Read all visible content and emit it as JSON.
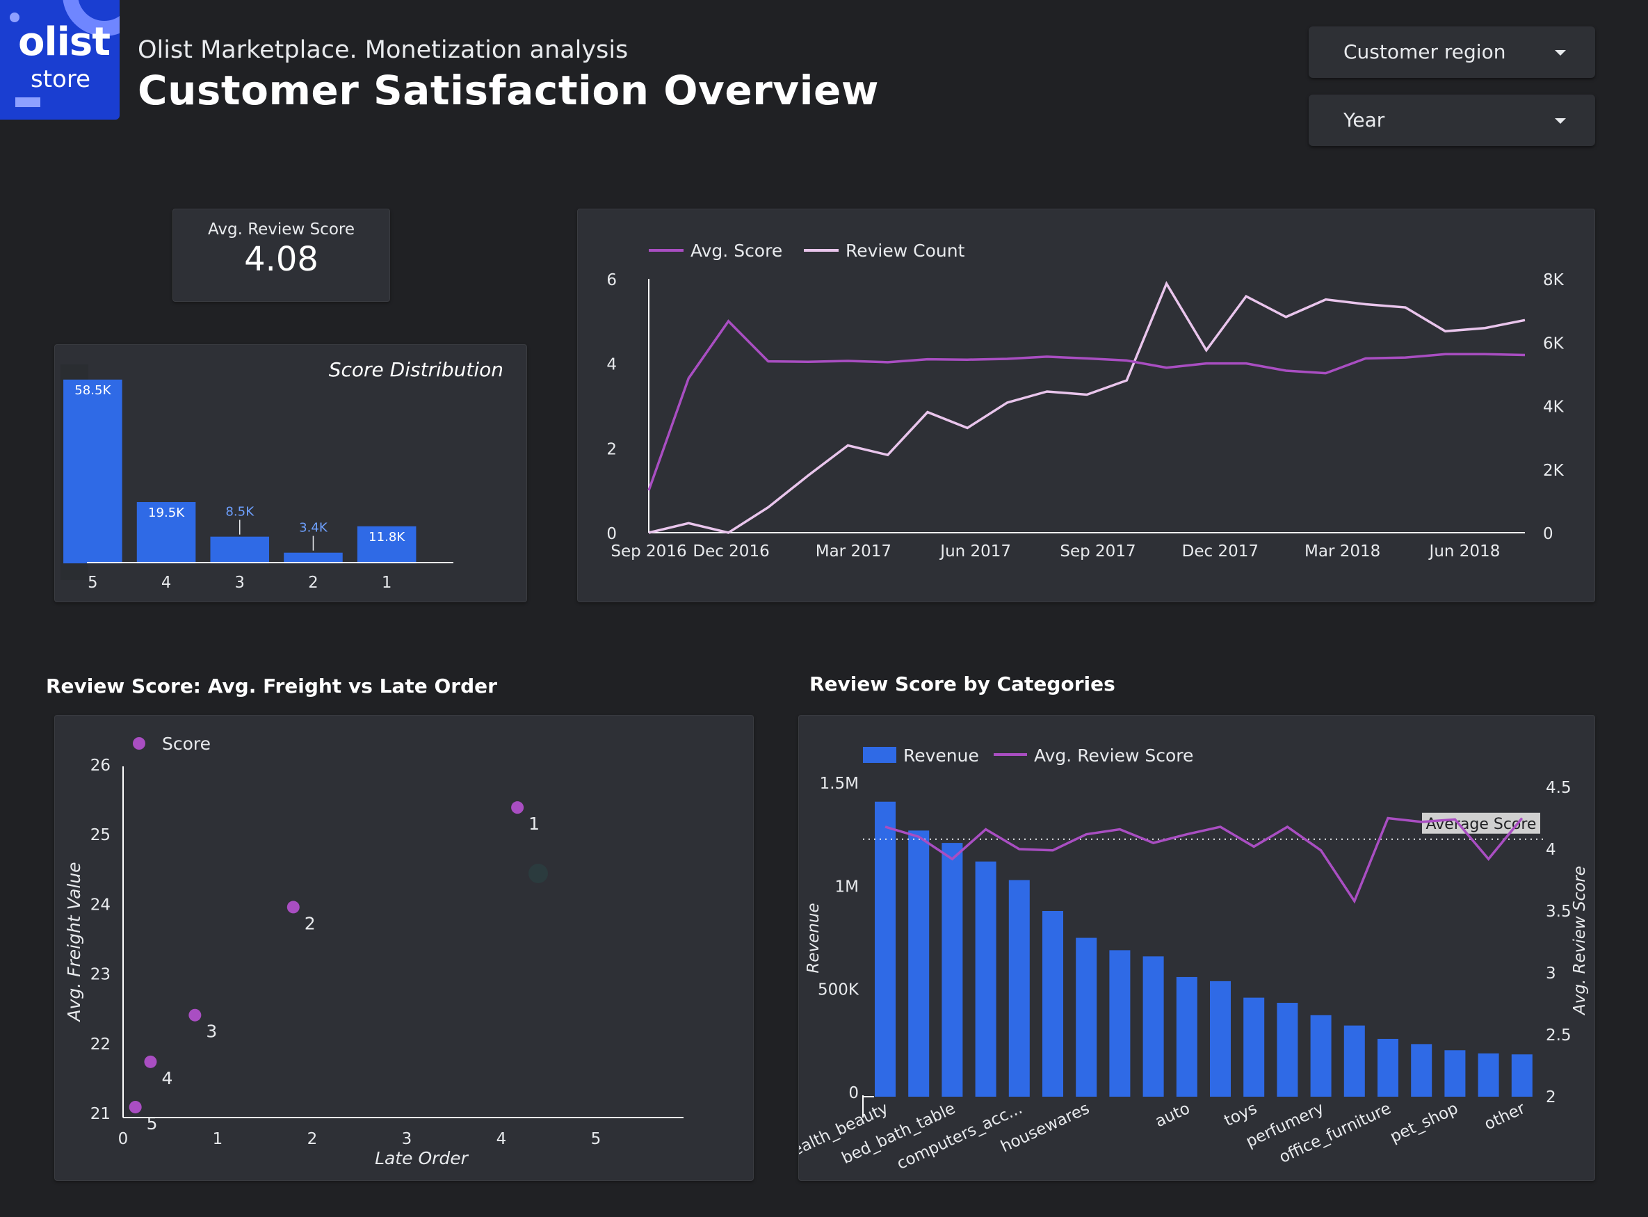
{
  "header": {
    "logo_line1": "olist",
    "logo_line2": "store",
    "subtitle": "Olist Marketplace. Monetization analysis",
    "title": "Customer Satisfaction Overview"
  },
  "filters": {
    "region_label": "Customer region",
    "year_label": "Year"
  },
  "kpi": {
    "label": "Avg. Review Score",
    "value": "4.08"
  },
  "colors": {
    "background": "#202124",
    "panel": "#2e3036",
    "bar_blue": "#2f6ae6",
    "avg_score_purple": "#a94ec2",
    "review_count_pink": "#e9c5ec"
  },
  "sections": {
    "scatter_title": "Review Score: Avg. Freight vs Late Order",
    "categories_title": "Review Score by Categories"
  },
  "chart_data": [
    {
      "type": "bar",
      "title": "Score Distribution",
      "categories": [
        "5",
        "4",
        "3",
        "2",
        "1"
      ],
      "values": [
        58.5,
        19.5,
        8.5,
        3.4,
        11.8
      ],
      "data_labels": [
        "58.5K",
        "19.5K",
        "8.5K",
        "3.4K",
        "11.8K"
      ],
      "grid": false
    },
    {
      "type": "line",
      "legend": [
        "Avg. Score",
        "Review Count"
      ],
      "legend_position": "top-left",
      "x_ticks": [
        "Sep 2016",
        "Dec 2016",
        "Mar 2017",
        "Jun 2017",
        "Sep 2017",
        "Dec 2017",
        "Mar 2018",
        "Jun 2018"
      ],
      "x": [
        "Sep 2016",
        "Oct 2016",
        "Dec 2016",
        "Jan 2017",
        "Feb 2017",
        "Mar 2017",
        "Apr 2017",
        "May 2017",
        "Jun 2017",
        "Jul 2017",
        "Aug 2017",
        "Sep 2017",
        "Oct 2017",
        "Nov 2017",
        "Dec 2017",
        "Jan 2018",
        "Feb 2018",
        "Mar 2018",
        "Apr 2018",
        "May 2018",
        "Jun 2018",
        "Jul 2018",
        "Aug 2018"
      ],
      "y_left": {
        "ticks": [
          "0",
          "2",
          "4",
          "6"
        ],
        "range": [
          0,
          6
        ]
      },
      "y_right": {
        "ticks": [
          "0",
          "2K",
          "4K",
          "6K",
          "8K"
        ],
        "range": [
          0,
          8000
        ]
      },
      "series": [
        {
          "name": "Avg. Score",
          "axis": "left",
          "values": [
            1.0,
            3.65,
            5.0,
            4.05,
            4.04,
            4.06,
            4.03,
            4.1,
            4.09,
            4.11,
            4.16,
            4.12,
            4.07,
            3.9,
            4.0,
            4.0,
            3.83,
            3.77,
            4.12,
            4.14,
            4.22,
            4.22,
            4.2
          ]
        },
        {
          "name": "Review Count",
          "axis": "right",
          "values": [
            0,
            300,
            0,
            800,
            1800,
            2750,
            2450,
            3800,
            3300,
            4100,
            4450,
            4350,
            4800,
            7850,
            5750,
            7450,
            6800,
            7350,
            7200,
            7100,
            6350,
            6450,
            6700
          ]
        }
      ]
    },
    {
      "type": "scatter",
      "legend": [
        "Score"
      ],
      "xlabel": "Late Order",
      "ylabel": "Avg. Freight Value",
      "xlim": [
        0,
        5
      ],
      "ylim": [
        21,
        26
      ],
      "x_ticks": [
        "0",
        "1",
        "2",
        "3",
        "4",
        "5"
      ],
      "y_ticks": [
        "21",
        "22",
        "23",
        "24",
        "25",
        "26"
      ],
      "points": [
        {
          "label": "1",
          "x": 4.17,
          "y": 25.45
        },
        {
          "label": "2",
          "x": 1.8,
          "y": 24.02
        },
        {
          "label": "3",
          "x": 0.76,
          "y": 22.47
        },
        {
          "label": "4",
          "x": 0.29,
          "y": 21.8
        },
        {
          "label": "5",
          "x": 0.13,
          "y": 21.15
        }
      ]
    },
    {
      "type": "bar",
      "legend": [
        "Revenue",
        "Avg. Review Score"
      ],
      "ylabel": "Revenue",
      "ylabel_right": "Avg. Review Score",
      "ylim": [
        0,
        1500000
      ],
      "ylim_right": [
        2,
        4.5
      ],
      "y_ticks": [
        "0",
        "500K",
        "1M",
        "1.5M"
      ],
      "y_ticks_right": [
        "2",
        "2.5",
        "3",
        "3.5",
        "4",
        "4.5"
      ],
      "reference_line": {
        "label": "Average Score",
        "value": 4.08
      },
      "categories": [
        "health_beauty",
        "bed_bath_table",
        "computers_acc...",
        "housewares",
        "auto",
        "toys",
        "perfumery",
        "office_furniture",
        "pet_shop",
        "other"
      ],
      "category_labels": [
        "health_beauty",
        "",
        "bed_bath_table",
        "",
        "computers_acc...",
        "",
        "housewares",
        "",
        "",
        "auto",
        "",
        "toys",
        "",
        "perfumery",
        "",
        "office_furniture",
        "",
        "pet_shop",
        "",
        "other"
      ],
      "series": [
        {
          "name": "Revenue",
          "values": [
            1430000,
            1290000,
            1230000,
            1140000,
            1050000,
            900000,
            770000,
            710000,
            680000,
            580000,
            560000,
            480000,
            455000,
            395000,
            345000,
            280000,
            255000,
            225000,
            210000,
            205000
          ]
        },
        {
          "name": "Avg. Review Score",
          "values": [
            4.18,
            4.1,
            3.92,
            4.16,
            4.0,
            3.99,
            4.12,
            4.16,
            4.05,
            4.12,
            4.18,
            4.02,
            4.18,
            3.99,
            3.58,
            4.25,
            4.22,
            4.24,
            3.92,
            4.25
          ]
        }
      ]
    }
  ]
}
